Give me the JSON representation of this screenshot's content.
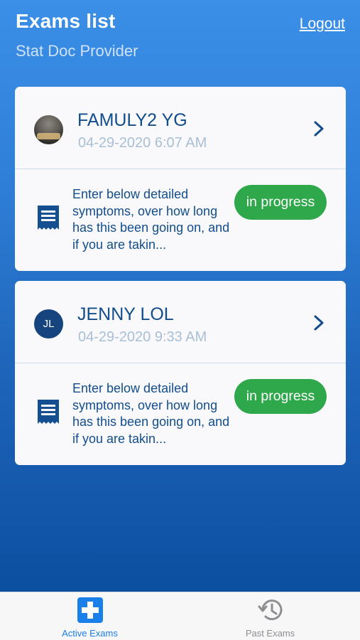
{
  "header": {
    "title": "Exams list",
    "subtitle": "Stat Doc Provider",
    "logout_label": "Logout"
  },
  "exams": [
    {
      "avatar_type": "photo",
      "avatar_initials": "",
      "patient_name": "FAMULY2 YG",
      "date": "04-29-2020 6:07 AM",
      "symptoms": "Enter below detailed symptoms, over how long has this been going on, and if you are takin...",
      "status": "in progress"
    },
    {
      "avatar_type": "initials",
      "avatar_initials": "JL",
      "patient_name": "JENNY LOL",
      "date": "04-29-2020 9:33 AM",
      "symptoms": "Enter below detailed symptoms, over how long has this been going on, and if you are takin...",
      "status": "in progress"
    }
  ],
  "tabs": [
    {
      "label": "Active Exams",
      "icon": "plus-square-icon",
      "active": true
    },
    {
      "label": "Past Exams",
      "icon": "history-icon",
      "active": false
    }
  ],
  "colors": {
    "accent": "#1a7fe8",
    "status_green": "#2ea84a",
    "name_blue": "#124d8c",
    "date_gray_blue": "#a8bfd6"
  }
}
